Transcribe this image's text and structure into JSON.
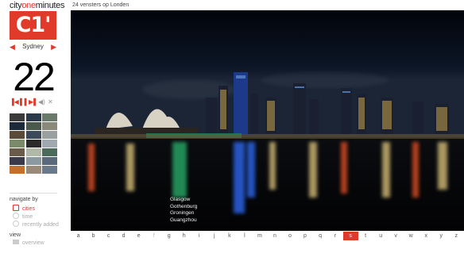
{
  "brand": {
    "prefix": "city",
    "highlight": "one",
    "suffix": "minutes",
    "logo": "C1'"
  },
  "colors": {
    "accent": "#e03a2b"
  },
  "city_selector": {
    "name": "Sydney",
    "prev_icon": "triangle-left-icon",
    "next_icon": "triangle-right-icon"
  },
  "hour": "22",
  "player_controls": [
    "skip-back-icon",
    "pause-icon",
    "skip-forward-icon",
    "volume-icon",
    "shuffle-icon"
  ],
  "page_title": "24 vensters op Londen",
  "navigate": {
    "label": "navigate by",
    "items": [
      {
        "label": "cities",
        "active": true
      },
      {
        "label": "time",
        "active": false
      },
      {
        "label": "recently added",
        "active": false
      }
    ]
  },
  "view": {
    "label": "view",
    "items": [
      {
        "label": "overview"
      }
    ]
  },
  "cities_on_letter": [
    "Glasgow",
    "Gothenburg",
    "Groningen",
    "Guangzhou"
  ],
  "alphabet": [
    "a",
    "b",
    "c",
    "d",
    "e",
    "f",
    "g",
    "h",
    "i",
    "j",
    "k",
    "l",
    "m",
    "n",
    "o",
    "p",
    "q",
    "r",
    "s",
    "t",
    "u",
    "v",
    "w",
    "x",
    "y",
    "z"
  ],
  "alphabet_active": "s",
  "alphabet_dim": [
    "f"
  ],
  "thumbnail_colors": [
    "#3a3a3a",
    "#2a3a4a",
    "#6a7a6a",
    "#1c2a3a",
    "#4a5a4a",
    "#8a8a7a",
    "#5a4a3a",
    "#3a4a5a",
    "#9aa0a0",
    "#7a8a6a",
    "#2a2a2a",
    "#a0a8b0",
    "#6a5a4a",
    "#b0b8a8",
    "#4a6a5a",
    "#3a3a4a",
    "#8a9aa0",
    "#5a6a7a",
    "#c07030",
    "#9a8a7a",
    "#6a7a8a"
  ]
}
